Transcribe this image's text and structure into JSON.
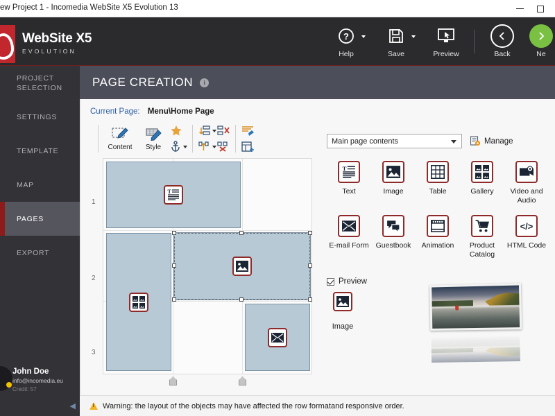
{
  "window": {
    "title": "ew Project 1 - Incomedia WebSite X5 Evolution 13",
    "minimize": "minimize-button",
    "maximize": "maximize-button"
  },
  "brand": {
    "name": "WebSite X5",
    "tagline": "EVOLUTION",
    "accent": "#c1272d"
  },
  "header_buttons": [
    {
      "label": "Help",
      "icon": "question-circle-icon",
      "has_caret": true
    },
    {
      "label": "Save",
      "icon": "floppy-disk-icon",
      "has_caret": true
    },
    {
      "label": "Preview",
      "icon": "monitor-cursor-icon",
      "has_caret": false
    },
    {
      "label": "Back",
      "icon": "chevron-left-circle-icon",
      "has_caret": false
    },
    {
      "label": "Ne",
      "icon": "chevron-right-circle-icon",
      "has_caret": false
    }
  ],
  "sidebar": {
    "items": [
      {
        "label": "PROJECT SELECTION",
        "active": false
      },
      {
        "label": "SETTINGS",
        "active": false
      },
      {
        "label": "TEMPLATE",
        "active": false
      },
      {
        "label": "MAP",
        "active": false
      },
      {
        "label": "PAGES",
        "active": true
      },
      {
        "label": "EXPORT",
        "active": false
      }
    ],
    "user": {
      "name": "John Doe",
      "email": "info@incomedia.eu",
      "credit": "Credit: 57"
    },
    "collapse_icon": "◀"
  },
  "page": {
    "title": "PAGE CREATION",
    "info_icon": "i",
    "current_page_label": "Current Page:",
    "current_page_value": "Menu\\Home Page"
  },
  "edit_toolbar": {
    "content_label": "Content",
    "style_label": "Style",
    "buttons": [
      "content-button",
      "style-button",
      "star-button",
      "anchor-button",
      "insert-row-button",
      "delete-row-button",
      "insert-column-button",
      "delete-column-button",
      "edit-layout-button",
      "responsive-button"
    ]
  },
  "layout_grid": {
    "row_numbers": [
      "1",
      "2",
      "3"
    ],
    "cells": [
      {
        "type": "text-cell",
        "icon": "text-icon",
        "row": 1,
        "col": "1-2",
        "selected": false
      },
      {
        "type": "gallery-cell",
        "icon": "gallery-icon",
        "row": "2-3",
        "col": 1,
        "selected": false
      },
      {
        "type": "image-cell",
        "icon": "image-icon",
        "row": 2,
        "col": "2-3",
        "selected": true
      },
      {
        "type": "email-cell",
        "icon": "email-icon",
        "row": 3,
        "col": 3,
        "selected": false
      }
    ],
    "column_handles": 2
  },
  "right_panel": {
    "select_value": "Main page contents",
    "manage_label": "Manage",
    "widgets": [
      {
        "label": "Text",
        "icon": "text-icon"
      },
      {
        "label": "Image",
        "icon": "image-icon"
      },
      {
        "label": "Table",
        "icon": "table-icon"
      },
      {
        "label": "Gallery",
        "icon": "gallery-icon"
      },
      {
        "label": "Video and Audio",
        "icon": "video-audio-icon"
      },
      {
        "label": "E-mail Form",
        "icon": "email-icon"
      },
      {
        "label": "Guestbook",
        "icon": "guestbook-icon"
      },
      {
        "label": "Animation",
        "icon": "animation-icon"
      },
      {
        "label": "Product Catalog",
        "icon": "cart-icon"
      },
      {
        "label": "HTML Code",
        "icon": "code-icon"
      }
    ],
    "preview": {
      "checkbox_label": "Preview",
      "checked": true,
      "selected_item_label": "Image",
      "selected_item_icon": "image-icon",
      "thumbnail_alt": "lake-landscape-thumbnail"
    }
  },
  "warning": {
    "icon": "warning-triangle-icon",
    "text": "Warning: the layout of the objects may have affected the row formatand responsive order."
  }
}
